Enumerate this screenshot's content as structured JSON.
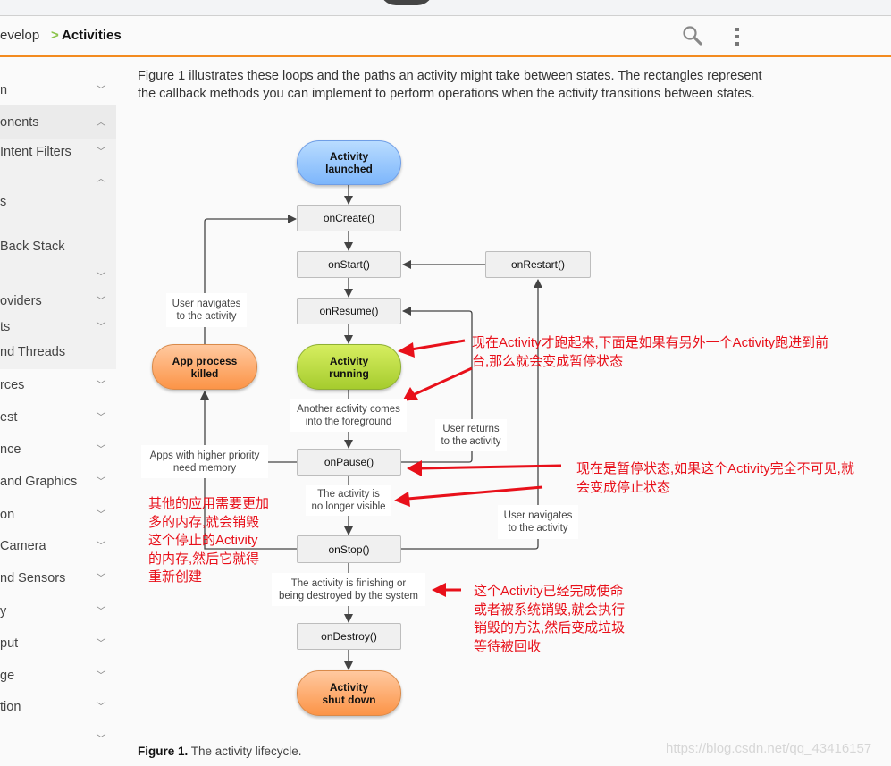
{
  "header": {
    "breadcrumb_parent": "evelop",
    "breadcrumb_separator": ">",
    "breadcrumb_current": "Activities",
    "search_icon": "search-icon",
    "more_icon": "more-vert-icon"
  },
  "sidebar": {
    "items": [
      {
        "label": "n",
        "chevron": "down"
      },
      {
        "label": "onents",
        "chevron": "up"
      },
      {
        "label": " Intent Filters",
        "chevron": "down"
      },
      {
        "label": "",
        "chevron": "up"
      },
      {
        "label": "s",
        "chevron": ""
      },
      {
        "label": " Back Stack",
        "chevron": ""
      },
      {
        "label": "",
        "chevron": "down"
      },
      {
        "label": "oviders",
        "chevron": "down"
      },
      {
        "label": "ts",
        "chevron": "down"
      },
      {
        "label": "nd Threads",
        "chevron": ""
      },
      {
        "label": "rces",
        "chevron": "down"
      },
      {
        "label": "est",
        "chevron": "down"
      },
      {
        "label": "nce",
        "chevron": "down"
      },
      {
        "label": "and Graphics",
        "chevron": "down"
      },
      {
        "label": "on",
        "chevron": "down"
      },
      {
        "label": "Camera",
        "chevron": "down"
      },
      {
        "label": "nd Sensors",
        "chevron": "down"
      },
      {
        "label": "y",
        "chevron": "down"
      },
      {
        "label": "put",
        "chevron": "down"
      },
      {
        "label": "ge",
        "chevron": "down"
      },
      {
        "label": "tion",
        "chevron": "down"
      },
      {
        "label": "",
        "chevron": "down"
      }
    ]
  },
  "intro": "Figure 1 illustrates these loops and the paths an activity might take between states. The rectangles represent the callback methods you can implement to perform operations when the activity transitions between states.",
  "diagram": {
    "launched": "Activity launched",
    "onCreate": "onCreate()",
    "onStart": "onStart()",
    "onRestart": "onRestart()",
    "onResume": "onResume()",
    "running": "Activity running",
    "killed": "App process killed",
    "onPause": "onPause()",
    "onStop": "onStop()",
    "onDestroy": "onDestroy()",
    "shutdown": "Activity shut down",
    "label_nav_left": [
      "User navigates",
      "to the activity"
    ],
    "label_foreground": [
      "Another activity comes",
      "into the foreground"
    ],
    "label_returns": [
      "User returns",
      "to the activity"
    ],
    "label_memory": [
      "Apps with higher priority",
      "need memory"
    ],
    "label_not_visible": [
      "The activity is",
      "no longer visible"
    ],
    "label_nav_right": [
      "User navigates",
      "to the activity"
    ],
    "label_finishing": [
      "The activity is finishing or",
      "being destroyed by the system"
    ]
  },
  "annotations": {
    "running_note": [
      "现在Activity才跑起来,下面是如果有另外一个Activity跑进到前",
      "台,那么就会变成暂停状态"
    ],
    "pause_note": [
      "现在是暂停状态,如果这个Activity完全不可见,就",
      "会变成停止状态"
    ],
    "memory_note": [
      "其他的应用需要更加",
      "多的内存,就会销毁",
      "这个停止的Activity",
      "的内存,然后它就得",
      "重新创建"
    ],
    "destroy_note": [
      "这个Activity已经完成使命",
      "或者被系统销毁,就会执行",
      "销毁的方法,然后变成垃圾",
      "等待被回收"
    ],
    "color": "#e8101a"
  },
  "caption": {
    "bold": "Figure 1.",
    "text": " The activity lifecycle."
  },
  "watermark": "https://blog.csdn.net/qq_43416157"
}
